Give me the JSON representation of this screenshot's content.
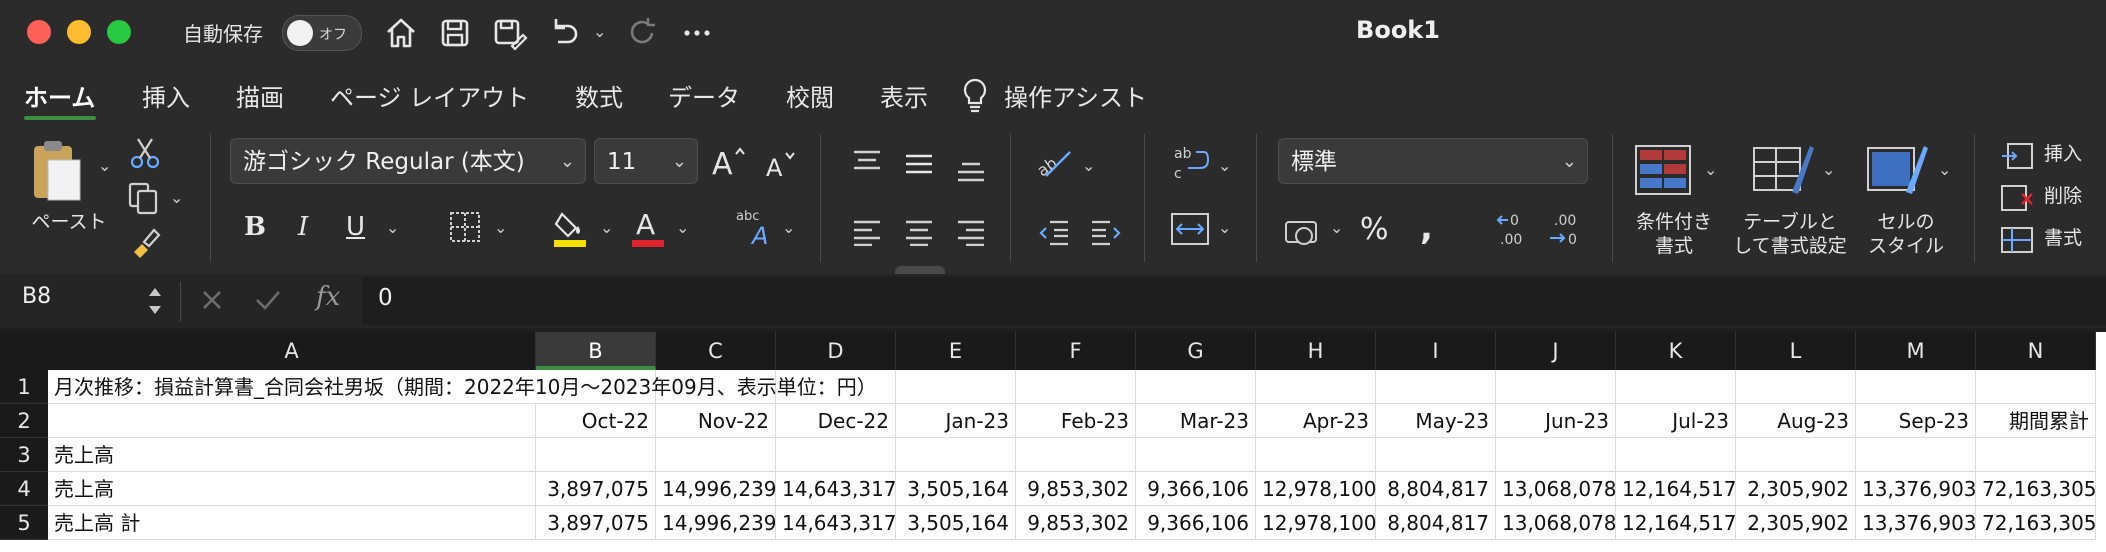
{
  "window": {
    "title": "Book1",
    "autosave_label": "自動保存",
    "autosave_state": "オフ"
  },
  "menu": {
    "tabs": [
      "ホーム",
      "挿入",
      "描画",
      "ページ レイアウト",
      "数式",
      "データ",
      "校閲",
      "表示",
      "操作アシスト"
    ],
    "active": "ホーム"
  },
  "ribbon": {
    "paste_label": "ペースト",
    "font_name": "游ゴシック Regular (本文)",
    "font_size": "11",
    "number_format": "標準",
    "conditional_format_label": [
      "条件付き",
      "書式"
    ],
    "table_format_label": [
      "テーブルと",
      "して書式設定"
    ],
    "cell_style_label": [
      "セルの",
      "スタイル"
    ],
    "insert_label": "挿入",
    "delete_label": "削除",
    "format_label": "書式",
    "colors": {
      "highlight": "#f5e000",
      "font": "#e0242b",
      "accent": "#3e8e41"
    }
  },
  "formula_bar": {
    "cell_ref": "B8",
    "value": "0",
    "fx": "fx"
  },
  "sheet": {
    "columns": [
      "A",
      "B",
      "C",
      "D",
      "E",
      "F",
      "G",
      "H",
      "I",
      "J",
      "K",
      "L",
      "M",
      "N"
    ],
    "selected_column": "B",
    "rows": [
      {
        "num": "1",
        "cells": [
          "月次推移：損益計算書_合同会社男坂（期間：2022年10月〜2023年09月、表示単位：円）",
          "",
          "",
          "",
          "",
          "",
          "",
          "",
          "",
          "",
          "",
          "",
          "",
          ""
        ]
      },
      {
        "num": "2",
        "cells": [
          "",
          "Oct-22",
          "Nov-22",
          "Dec-22",
          "Jan-23",
          "Feb-23",
          "Mar-23",
          "Apr-23",
          "May-23",
          "Jun-23",
          "Jul-23",
          "Aug-23",
          "Sep-23",
          "期間累計"
        ]
      },
      {
        "num": "3",
        "cells": [
          "売上高",
          "",
          "",
          "",
          "",
          "",
          "",
          "",
          "",
          "",
          "",
          "",
          "",
          ""
        ]
      },
      {
        "num": "4",
        "cells": [
          "売上高",
          "3,897,075",
          "14,996,239",
          "14,643,317",
          "3,505,164",
          "9,853,302",
          "9,366,106",
          "12,978,100",
          "8,804,817",
          "13,068,078",
          "12,164,517",
          "2,305,902",
          "13,376,903",
          "72,163,305"
        ]
      },
      {
        "num": "5",
        "cells": [
          "売上高 計",
          "3,897,075",
          "14,996,239",
          "14,643,317",
          "3,505,164",
          "9,853,302",
          "9,366,106",
          "12,978,100",
          "8,804,817",
          "13,068,078",
          "12,164,517",
          "2,305,902",
          "13,376,903",
          "72,163,305"
        ]
      }
    ]
  }
}
